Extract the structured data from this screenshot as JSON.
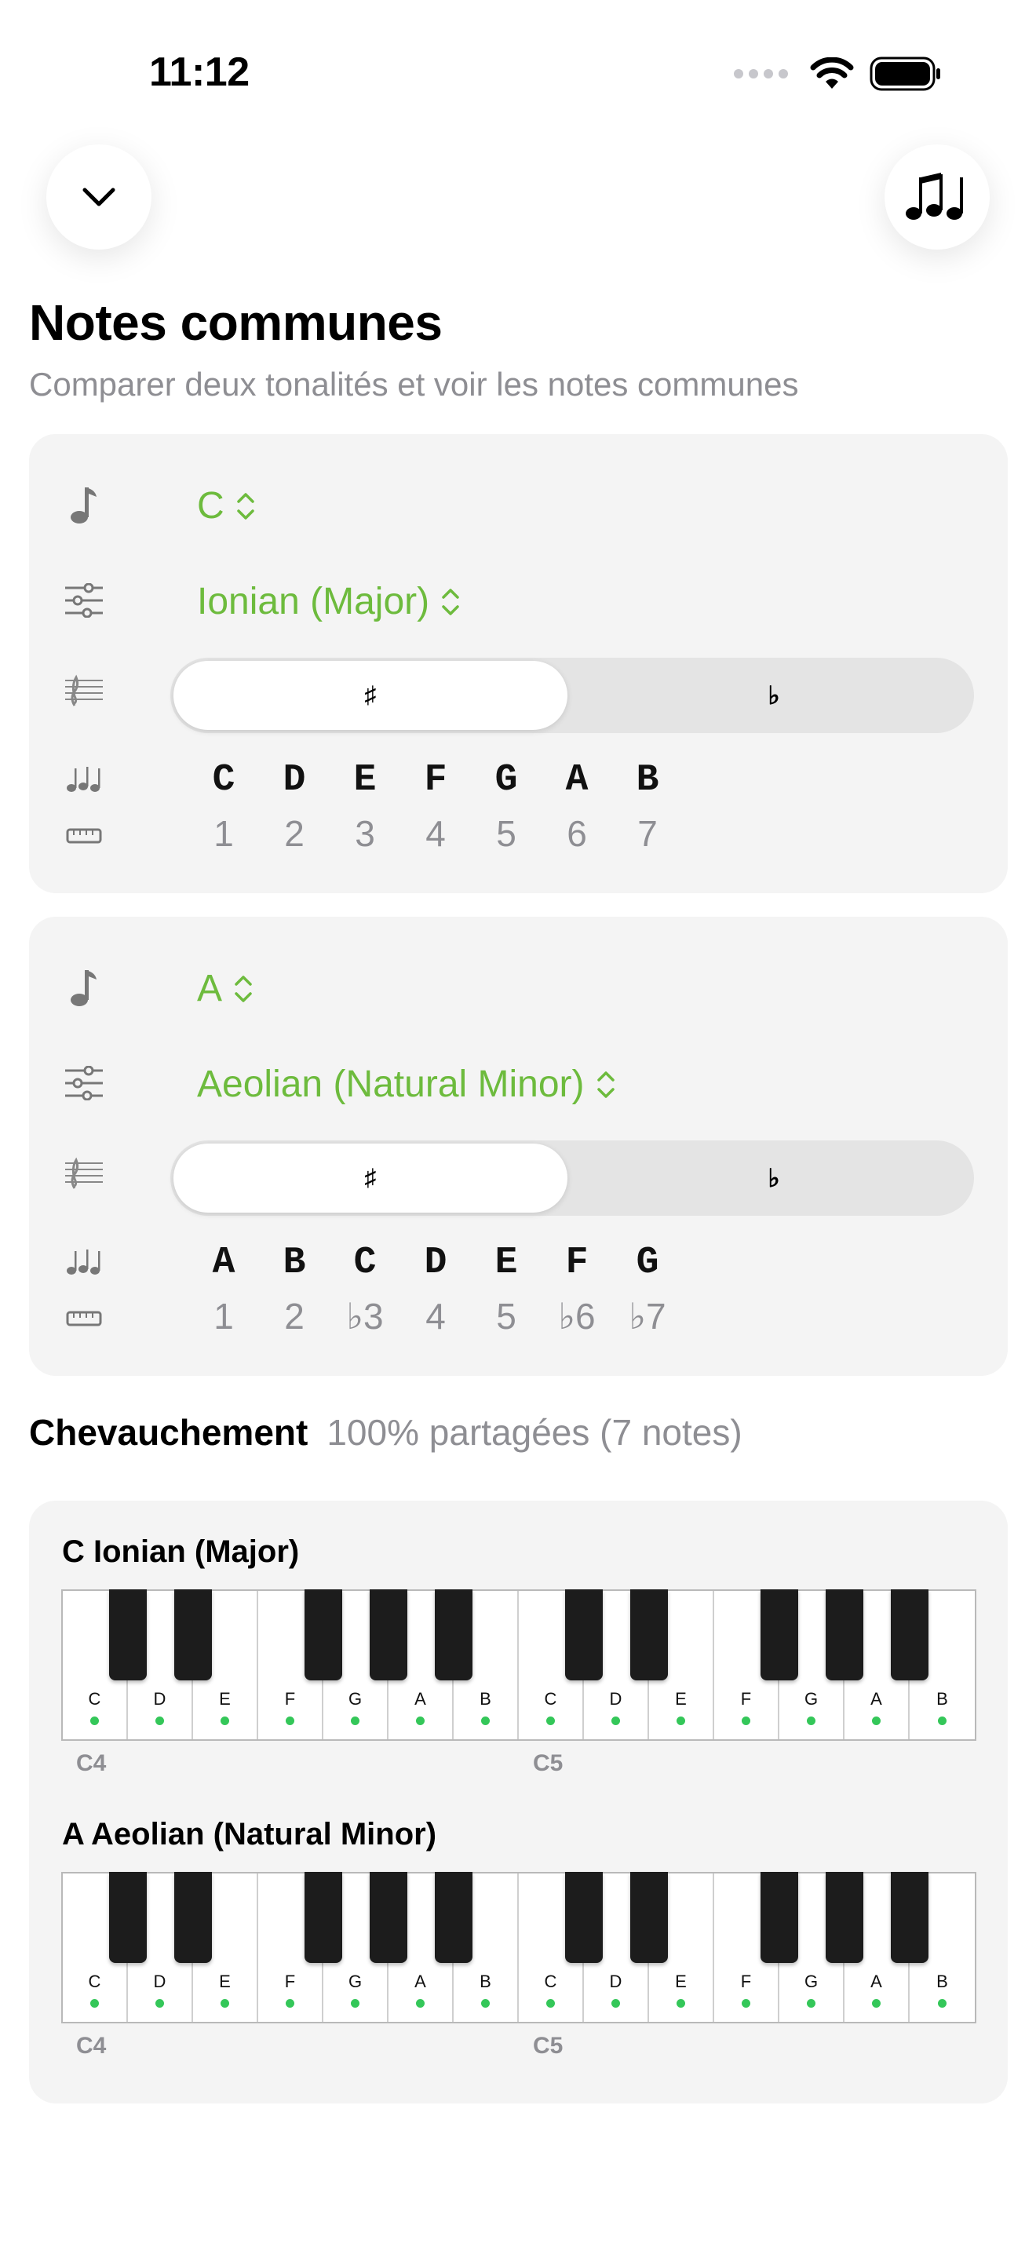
{
  "status_bar": {
    "time": "11:12"
  },
  "header": {
    "title": "Notes communes",
    "subtitle": "Comparer deux tonalités et voir les notes communes"
  },
  "scale1": {
    "root": "C",
    "mode": "Ionian (Major)",
    "sharp_label": "♯",
    "flat_label": "♭",
    "notes": [
      "C",
      "D",
      "E",
      "F",
      "G",
      "A",
      "B"
    ],
    "degrees": [
      "1",
      "2",
      "3",
      "4",
      "5",
      "6",
      "7"
    ]
  },
  "scale2": {
    "root": "A",
    "mode": "Aeolian (Natural Minor)",
    "sharp_label": "♯",
    "flat_label": "♭",
    "notes": [
      "A",
      "B",
      "C",
      "D",
      "E",
      "F",
      "G"
    ],
    "degrees": [
      "1",
      "2",
      "♭3",
      "4",
      "5",
      "♭6",
      "♭7"
    ]
  },
  "overlap": {
    "label": "Chevauchement",
    "summary": "100% partagées (7 notes)"
  },
  "keyboards": [
    {
      "title": "C Ionian (Major)",
      "white_keys": [
        "C",
        "D",
        "E",
        "F",
        "G",
        "A",
        "B",
        "C",
        "D",
        "E",
        "F",
        "G",
        "A",
        "B"
      ],
      "octave_labels": [
        "C4",
        "C5"
      ]
    },
    {
      "title": "A Aeolian (Natural Minor)",
      "white_keys": [
        "C",
        "D",
        "E",
        "F",
        "G",
        "A",
        "B",
        "C",
        "D",
        "E",
        "F",
        "G",
        "A",
        "B"
      ],
      "octave_labels": [
        "C4",
        "C5"
      ]
    }
  ],
  "colors": {
    "accent": "#6dbb3d",
    "dot": "#34c759",
    "card": "#f4f4f4"
  }
}
